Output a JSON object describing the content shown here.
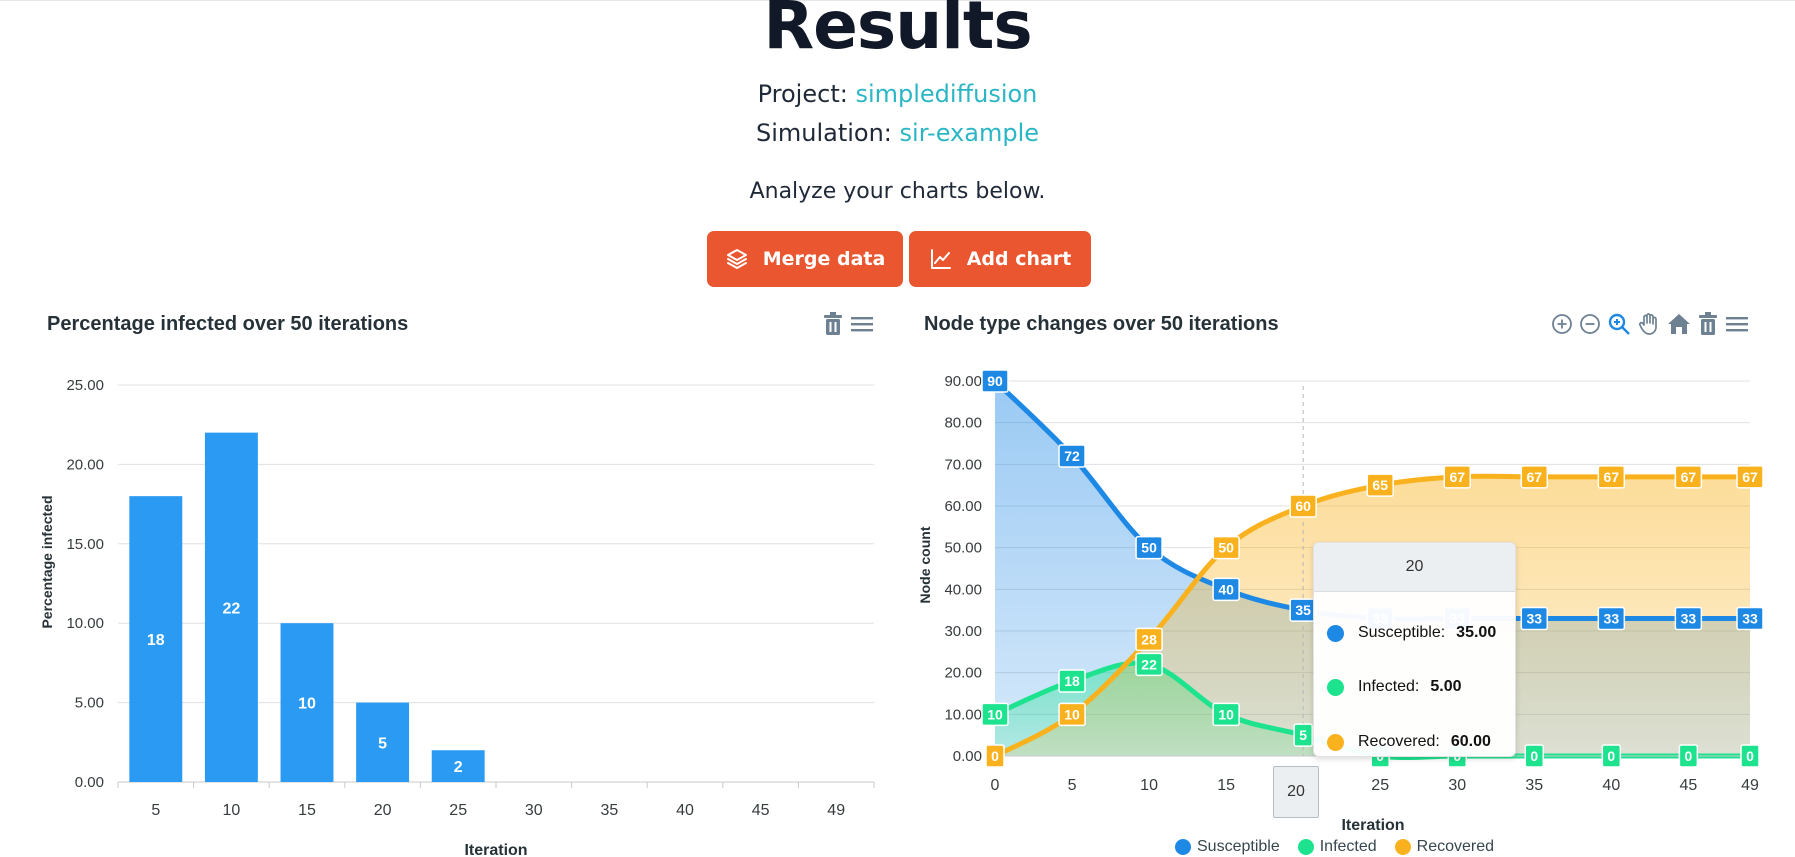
{
  "header": {
    "title": "Results",
    "project_label": "Project:",
    "project_name": "simplediffusion",
    "simulation_label": "Simulation:",
    "simulation_name": "sir-example",
    "subtitle": "Analyze your charts below."
  },
  "buttons": {
    "merge_label": "Merge data",
    "add_chart_label": "Add chart",
    "color": "#e9562f"
  },
  "chart_data": [
    {
      "type": "bar",
      "title": "Percentage infected over 50 iterations",
      "xlabel": "Iteration",
      "ylabel": "Percentage infected",
      "categories": [
        "5",
        "10",
        "15",
        "20",
        "25",
        "30",
        "35",
        "40",
        "45",
        "49"
      ],
      "values": [
        18,
        22,
        10,
        5,
        2,
        0,
        0,
        0,
        0,
        0
      ],
      "data_labels": [
        "18",
        "22",
        "10",
        "5",
        "2"
      ],
      "ylim": [
        0,
        25
      ],
      "yticks": [
        "0.00",
        "5.00",
        "10.00",
        "15.00",
        "20.00",
        "25.00"
      ],
      "color": "#2196f3",
      "grid": true
    },
    {
      "type": "area",
      "title": "Node type changes over 50 iterations",
      "xlabel": "Iteration",
      "ylabel": "Node count",
      "x": [
        0,
        5,
        10,
        15,
        20,
        25,
        30,
        35,
        40,
        45,
        49
      ],
      "series": [
        {
          "name": "Susceptible",
          "color": "#1e88e5",
          "values": [
            90,
            72,
            50,
            40,
            35,
            33,
            33,
            33,
            33,
            33,
            33
          ]
        },
        {
          "name": "Infected",
          "color": "#1de38f",
          "values": [
            10,
            18,
            22,
            10,
            5,
            0,
            0,
            0,
            0,
            0,
            0
          ]
        },
        {
          "name": "Recovered",
          "color": "#f9b21e",
          "values": [
            0,
            10,
            28,
            50,
            60,
            65,
            67,
            67,
            67,
            67,
            67
          ]
        }
      ],
      "ylim": [
        0,
        90
      ],
      "yticks": [
        "0.00",
        "10.00",
        "20.00",
        "30.00",
        "40.00",
        "50.00",
        "60.00",
        "70.00",
        "80.00",
        "90.00"
      ],
      "xticks": [
        "0",
        "5",
        "10",
        "15",
        "20",
        "25",
        "30",
        "35",
        "40",
        "45",
        "49"
      ],
      "grid": true,
      "legend_position": "bottom",
      "tooltip": {
        "x": "20",
        "rows": [
          {
            "label": "Susceptible:",
            "value": "35.00",
            "color": "#1e88e5"
          },
          {
            "label": "Infected:",
            "value": "5.00",
            "color": "#1de38f"
          },
          {
            "label": "Recovered:",
            "value": "60.00",
            "color": "#f9b21e"
          }
        ]
      },
      "crosshair_label": "20"
    }
  ],
  "toolbar": {
    "left_icons": [
      "trash-icon",
      "menu-icon"
    ],
    "right_icons": [
      "zoom-in-icon",
      "zoom-out-icon",
      "zoom-selection-icon",
      "pan-hand-icon",
      "home-icon",
      "trash-icon",
      "menu-icon"
    ],
    "active_color": "#1e88e5"
  }
}
